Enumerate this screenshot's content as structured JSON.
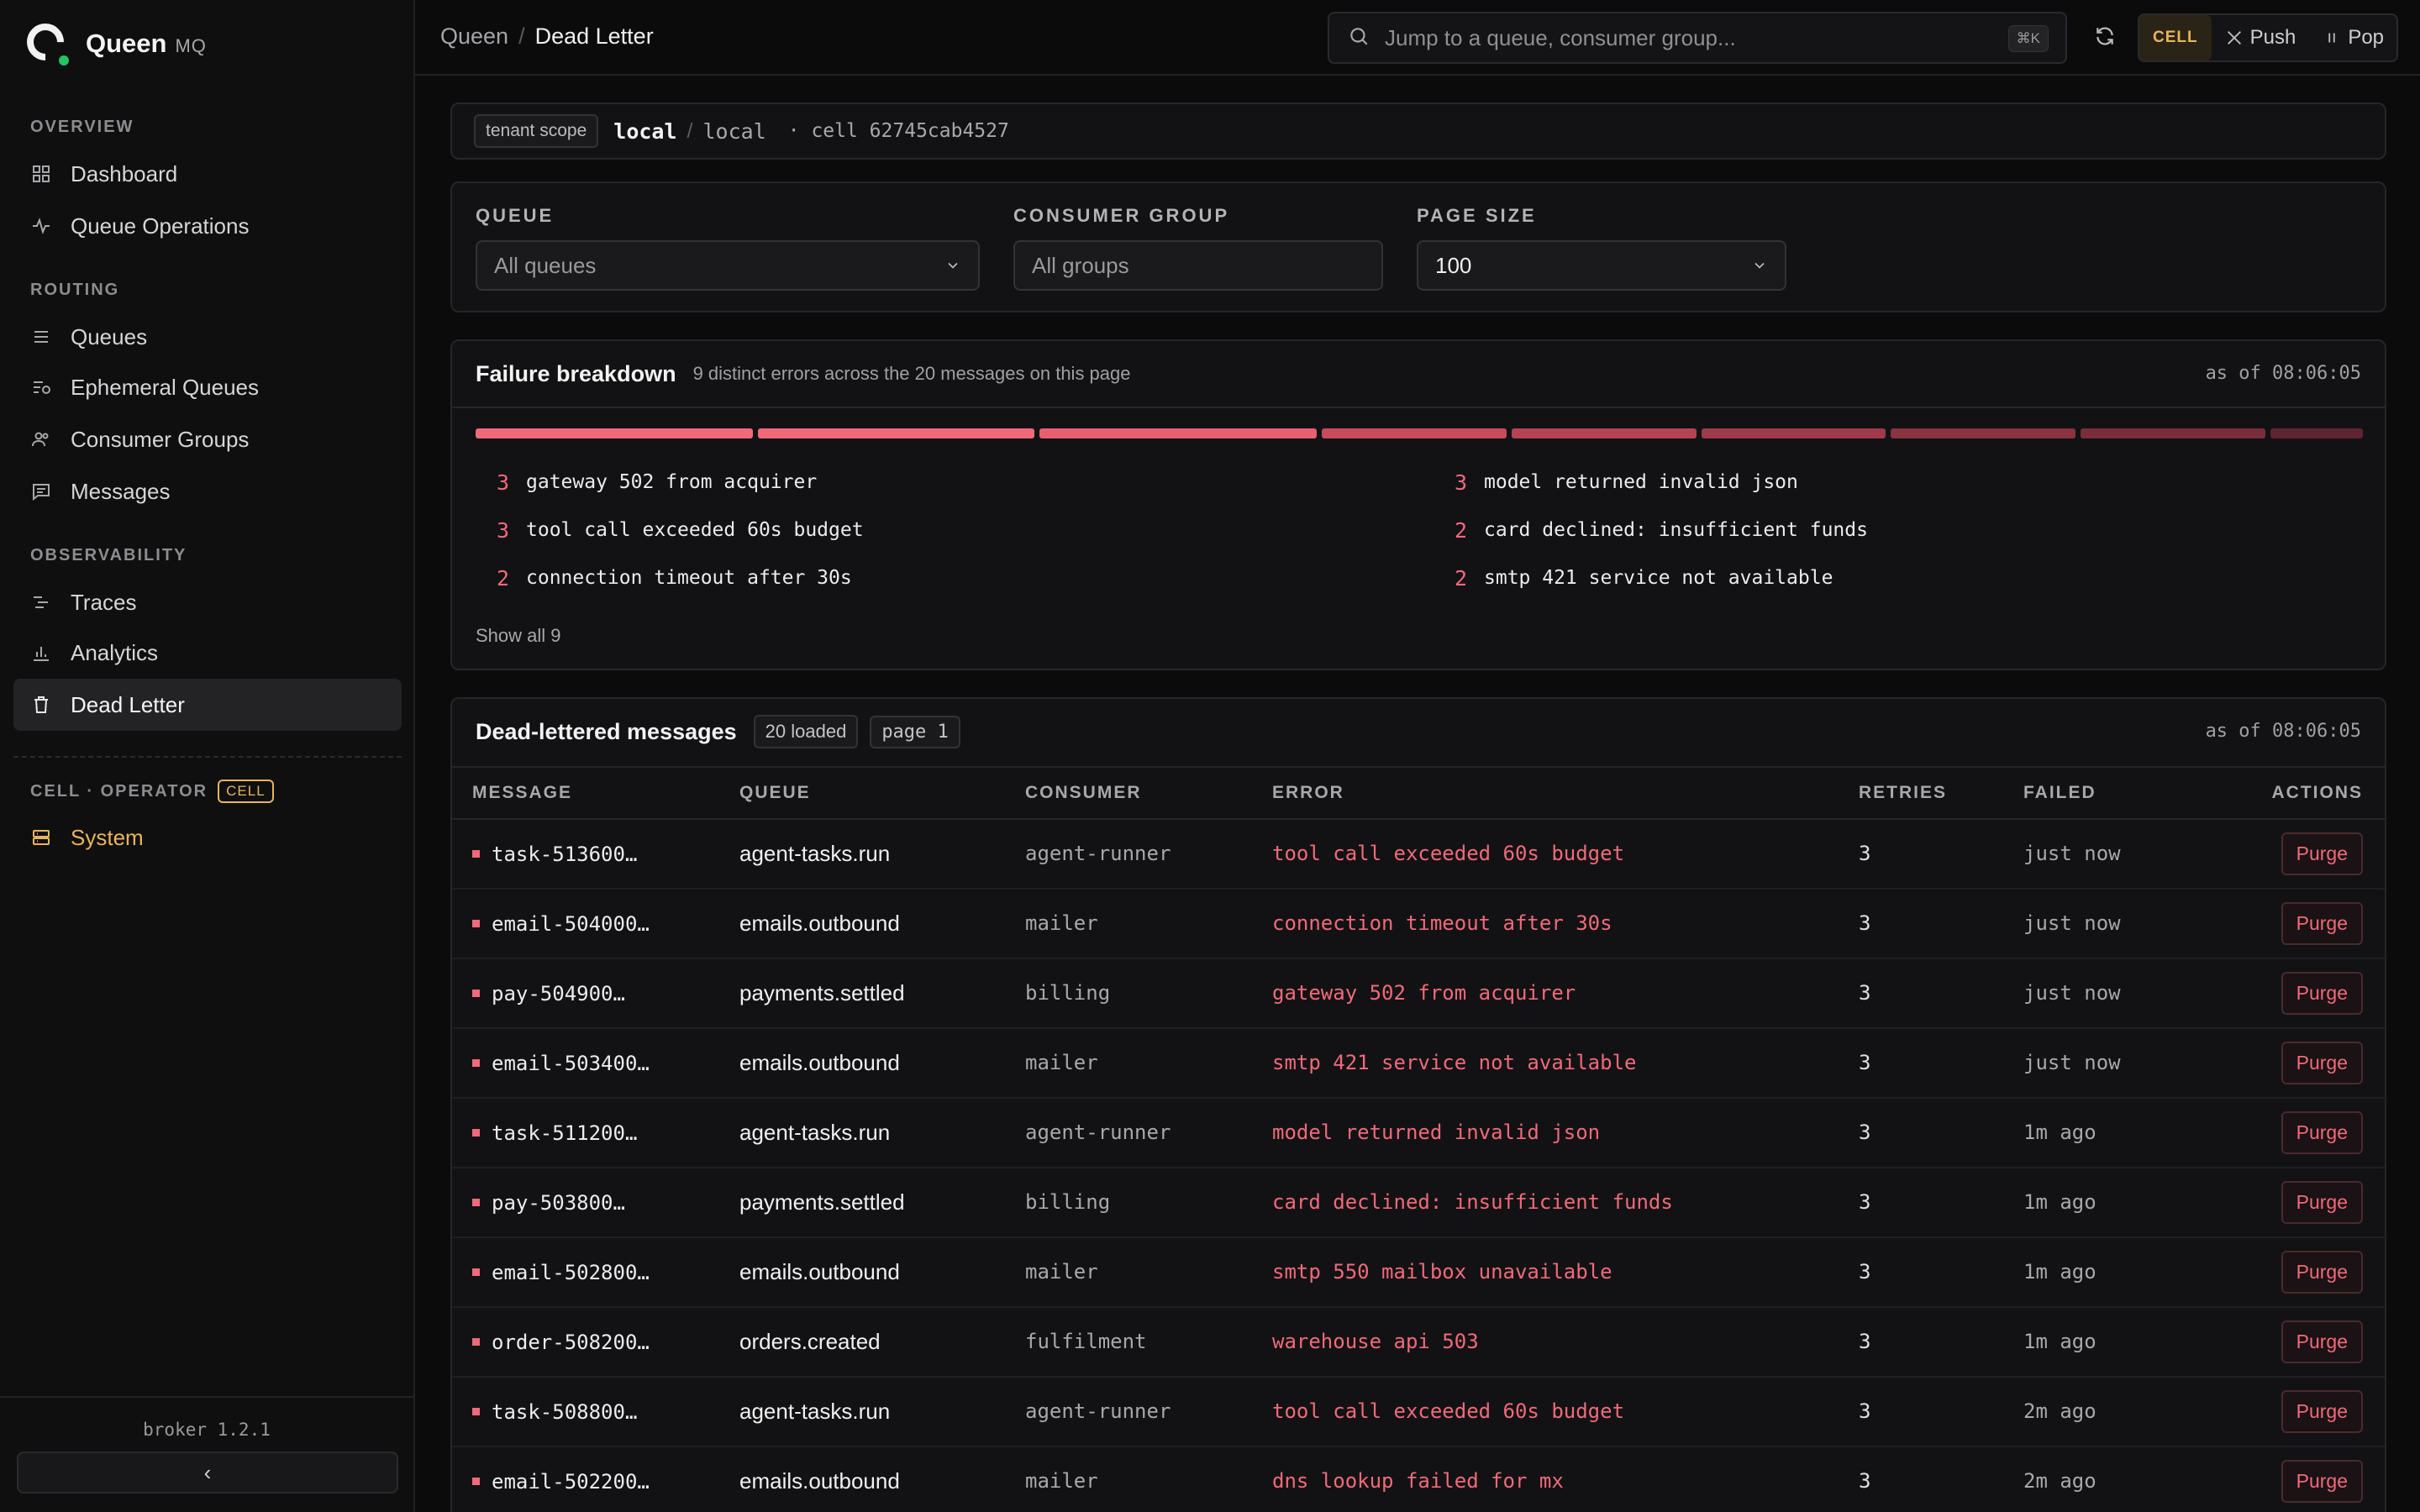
{
  "brand": {
    "name": "Queen",
    "suffix": "MQ"
  },
  "sidebar": {
    "sections": {
      "overview": "OVERVIEW",
      "routing": "ROUTING",
      "observability": "OBSERVABILITY",
      "cell_operator": "CELL · OPERATOR",
      "cell_badge": "CELL"
    },
    "items": {
      "dashboard": "Dashboard",
      "queue_operations": "Queue Operations",
      "queues": "Queues",
      "ephemeral_queues": "Ephemeral Queues",
      "consumer_groups": "Consumer Groups",
      "messages": "Messages",
      "traces": "Traces",
      "analytics": "Analytics",
      "dead_letter": "Dead Letter",
      "system": "System"
    },
    "broker_version": "broker 1.2.1",
    "collapse_icon": "chevron-left-icon"
  },
  "header": {
    "breadcrumb": [
      "Queen",
      "Dead Letter"
    ],
    "search_placeholder": "Jump to a queue, consumer group...",
    "search_shortcut": "⌘K",
    "mode": {
      "cell": "CELL",
      "push": "Push",
      "pop": "Pop"
    }
  },
  "scope": {
    "tag": "tenant scope",
    "tenant": "local",
    "namespace": "local",
    "cell": "· cell 62745cab4527"
  },
  "filters": {
    "queue": {
      "label": "QUEUE",
      "placeholder": "All queues"
    },
    "consumer_group": {
      "label": "CONSUMER GROUP",
      "placeholder": "All groups"
    },
    "page_size": {
      "label": "PAGE SIZE",
      "value": "100"
    }
  },
  "breakdown": {
    "title": "Failure breakdown",
    "subtitle": "9 distinct errors across the 20 messages on this page",
    "as_of": "as of 08:06:05",
    "show_all": "Show all 9",
    "segments": [
      3,
      3,
      3,
      2,
      2,
      2,
      2,
      2,
      1
    ],
    "errors": [
      {
        "count": "3",
        "text": "gateway 502 from acquirer"
      },
      {
        "count": "3",
        "text": "model returned invalid json"
      },
      {
        "count": "3",
        "text": "tool call exceeded 60s budget"
      },
      {
        "count": "2",
        "text": "card declined: insufficient funds"
      },
      {
        "count": "2",
        "text": "connection timeout after 30s"
      },
      {
        "count": "2",
        "text": "smtp 421 service not available"
      }
    ]
  },
  "messages": {
    "title": "Dead-lettered messages",
    "loaded": "20 loaded",
    "page": "page 1",
    "as_of": "as of 08:06:05",
    "columns": [
      "MESSAGE",
      "QUEUE",
      "CONSUMER",
      "ERROR",
      "RETRIES",
      "FAILED",
      "ACTIONS"
    ],
    "action_label": "Purge",
    "rows": [
      {
        "id": "task-513600…",
        "queue": "agent-tasks.run",
        "consumer": "agent-runner",
        "error": "tool call exceeded 60s budget",
        "retries": "3",
        "failed": "just now"
      },
      {
        "id": "email-504000…",
        "queue": "emails.outbound",
        "consumer": "mailer",
        "error": "connection timeout after 30s",
        "retries": "3",
        "failed": "just now"
      },
      {
        "id": "pay-504900…",
        "queue": "payments.settled",
        "consumer": "billing",
        "error": "gateway 502 from acquirer",
        "retries": "3",
        "failed": "just now"
      },
      {
        "id": "email-503400…",
        "queue": "emails.outbound",
        "consumer": "mailer",
        "error": "smtp 421 service not available",
        "retries": "3",
        "failed": "just now"
      },
      {
        "id": "task-511200…",
        "queue": "agent-tasks.run",
        "consumer": "agent-runner",
        "error": "model returned invalid json",
        "retries": "3",
        "failed": "1m ago"
      },
      {
        "id": "pay-503800…",
        "queue": "payments.settled",
        "consumer": "billing",
        "error": "card declined: insufficient funds",
        "retries": "3",
        "failed": "1m ago"
      },
      {
        "id": "email-502800…",
        "queue": "emails.outbound",
        "consumer": "mailer",
        "error": "smtp 550 mailbox unavailable",
        "retries": "3",
        "failed": "1m ago"
      },
      {
        "id": "order-508200…",
        "queue": "orders.created",
        "consumer": "fulfilment",
        "error": "warehouse api 503",
        "retries": "3",
        "failed": "1m ago"
      },
      {
        "id": "task-508800…",
        "queue": "agent-tasks.run",
        "consumer": "agent-runner",
        "error": "tool call exceeded 60s budget",
        "retries": "3",
        "failed": "2m ago"
      },
      {
        "id": "email-502200…",
        "queue": "emails.outbound",
        "consumer": "mailer",
        "error": "dns lookup failed for mx",
        "retries": "3",
        "failed": "2m ago"
      }
    ]
  },
  "colors": {
    "accent_error": "#f06a7a",
    "accent_cell": "#e9b45a",
    "status_ok": "#22c55e"
  }
}
